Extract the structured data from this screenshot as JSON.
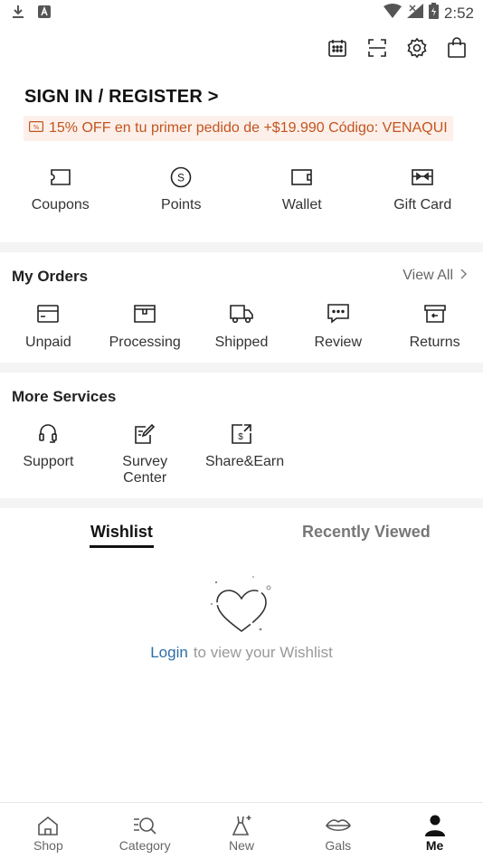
{
  "status_bar": {
    "time": "2:52"
  },
  "header": {
    "top_icons": [
      "calendar-icon",
      "scan-icon",
      "settings-gear-icon",
      "shopping-bag-icon"
    ],
    "sign_in_label": "SIGN IN / REGISTER >",
    "promo_text": "15% OFF en tu primer pedido de +$19.990 Código: VENAQUI"
  },
  "quick_links": [
    {
      "label": "Coupons",
      "icon": "coupon-icon"
    },
    {
      "label": "Points",
      "icon": "points-icon"
    },
    {
      "label": "Wallet",
      "icon": "wallet-icon"
    },
    {
      "label": "Gift Card",
      "icon": "gift-card-icon"
    }
  ],
  "orders": {
    "title": "My Orders",
    "view_all": "View All",
    "items": [
      {
        "label": "Unpaid",
        "icon": "unpaid-icon"
      },
      {
        "label": "Processing",
        "icon": "processing-icon"
      },
      {
        "label": "Shipped",
        "icon": "truck-icon"
      },
      {
        "label": "Review",
        "icon": "review-icon"
      },
      {
        "label": "Returns",
        "icon": "returns-icon"
      }
    ]
  },
  "services": {
    "title": "More Services",
    "items": [
      {
        "label": "Support",
        "icon": "headset-icon"
      },
      {
        "label": "Survey Center",
        "icon": "survey-icon"
      },
      {
        "label": "Share&Earn",
        "icon": "share-earn-icon"
      }
    ]
  },
  "tabs": {
    "wishlist": "Wishlist",
    "recently_viewed": "Recently Viewed",
    "active": "wishlist"
  },
  "wishlist_empty": {
    "login_link": "Login",
    "message": "to view your Wishlist"
  },
  "bottom_nav": [
    {
      "label": "Shop",
      "icon": "home-icon"
    },
    {
      "label": "Category",
      "icon": "category-search-icon"
    },
    {
      "label": "New",
      "icon": "new-dress-icon"
    },
    {
      "label": "Gals",
      "icon": "lips-icon"
    },
    {
      "label": "Me",
      "icon": "person-icon",
      "active": true
    }
  ],
  "colors": {
    "promo_bg": "#fdf0ea",
    "promo_text": "#c2541f",
    "link_blue": "#2d6ea8",
    "section_gap": "#f4f4f4"
  }
}
